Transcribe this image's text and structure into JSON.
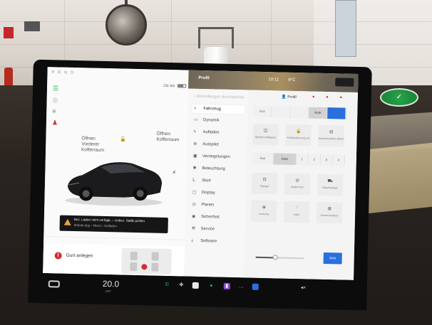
{
  "status_bar": {
    "gear_selector": "P R N D",
    "range": "211 km",
    "profile_top": "Profil",
    "time": "10:11",
    "temperature": "8°C"
  },
  "left_pane": {
    "front_trunk": "Öffnen\nVorderer\nKofferraum",
    "rear_trunk": "Öffnen\nKofferraum",
    "charge_warning_line1": "Bez. Laden nicht verfügb. – Unbez. Saldo prüfen",
    "charge_warning_line2": "Mobile App › Menü › Aufladen",
    "seatbelt_alert": "Gurt anlegen"
  },
  "settings": {
    "search_placeholder": "Einstellungen durchsuchen",
    "profile": "Profil",
    "nav_items": [
      {
        "label": "Fahrzeug",
        "icon": "toggle-icon",
        "active": true
      },
      {
        "label": "Dynamik",
        "icon": "car-icon",
        "active": false
      },
      {
        "label": "Aufladen",
        "icon": "bolt-icon",
        "active": false
      },
      {
        "label": "Autopilot",
        "icon": "steering-icon",
        "active": false
      },
      {
        "label": "Verriegelungen",
        "icon": "lock-icon",
        "active": false
      },
      {
        "label": "Beleuchtung",
        "icon": "bulb-icon",
        "active": false
      },
      {
        "label": "Sitze",
        "icon": "seat-icon",
        "active": false
      },
      {
        "label": "Display",
        "icon": "display-icon",
        "active": false
      },
      {
        "label": "Planen",
        "icon": "clock-icon",
        "active": false
      },
      {
        "label": "Sicherheit",
        "icon": "shield-icon",
        "active": false
      },
      {
        "label": "Service",
        "icon": "wrench-icon",
        "active": false
      },
      {
        "label": "Software",
        "icon": "download-icon",
        "active": false
      }
    ],
    "headlights_row": [
      "Aus",
      "",
      "",
      "Auto",
      ""
    ],
    "tiles_row1": [
      "Spiegel anklappen",
      "Kindersicherung ein",
      "Handschuhfach öffnen"
    ],
    "wipers_row": [
      "Aus",
      "Auto",
      "1",
      "2",
      "3",
      "4"
    ],
    "tiles_row2": [
      "Spiegel",
      "Angleichen",
      "Waschanlage"
    ],
    "tiles_row3": [
      "Lenkung",
      "Höhe",
      "Handschuhfach"
    ],
    "brightness_auto": "Auto"
  },
  "dock": {
    "cabin_temp": "20.0",
    "temp_sub": "OFF"
  },
  "background": {
    "sticker_text": "✓"
  }
}
